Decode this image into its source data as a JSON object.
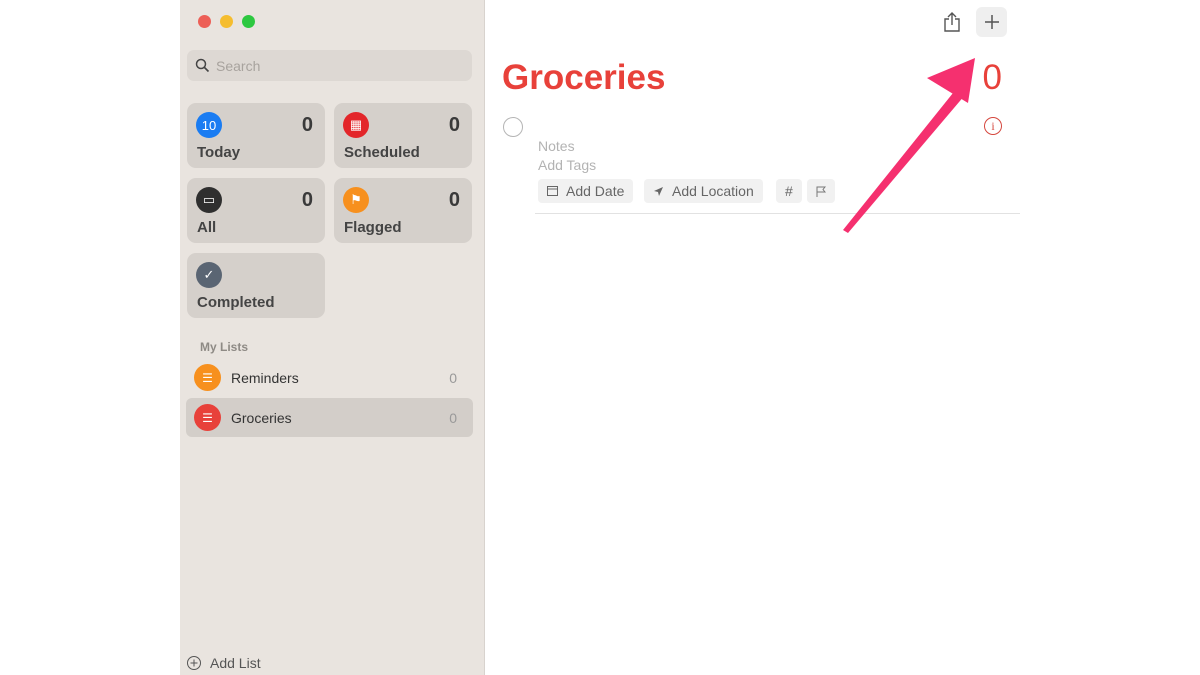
{
  "window": {
    "controls": [
      "close",
      "minimize",
      "maximize"
    ]
  },
  "sidebar": {
    "search": {
      "placeholder": "Search"
    },
    "smart_lists": [
      {
        "label": "Today",
        "count": "0",
        "icon": "calendar-today-icon",
        "color": "#1a7cf2",
        "glyph": "10"
      },
      {
        "label": "Scheduled",
        "count": "0",
        "icon": "calendar-icon",
        "color": "#e3262a",
        "glyph": "▦"
      },
      {
        "label": "All",
        "count": "0",
        "icon": "tray-icon",
        "color": "#2f2f2f",
        "glyph": "▭"
      },
      {
        "label": "Flagged",
        "count": "0",
        "icon": "flag-icon",
        "color": "#f7901e",
        "glyph": "⚑"
      },
      {
        "label": "Completed",
        "icon": "checkmark-icon",
        "color": "#5a6573",
        "glyph": "✓"
      }
    ],
    "my_lists_header": "My Lists",
    "lists": [
      {
        "label": "Reminders",
        "count": "0",
        "color": "#f7901e",
        "selected": false
      },
      {
        "label": "Groceries",
        "count": "0",
        "color": "#e8413a",
        "selected": true
      }
    ],
    "add_list": "Add List"
  },
  "main": {
    "title": "Groceries",
    "count": "0",
    "new_item": {
      "notes_placeholder": "Notes",
      "tags_placeholder": "Add Tags",
      "add_date": "Add Date",
      "add_location": "Add Location",
      "tag_glyph": "#"
    },
    "accent": "#e8413a"
  },
  "annotation": {
    "arrow_color": "#f5306f",
    "points_to": "add-reminder-button"
  }
}
